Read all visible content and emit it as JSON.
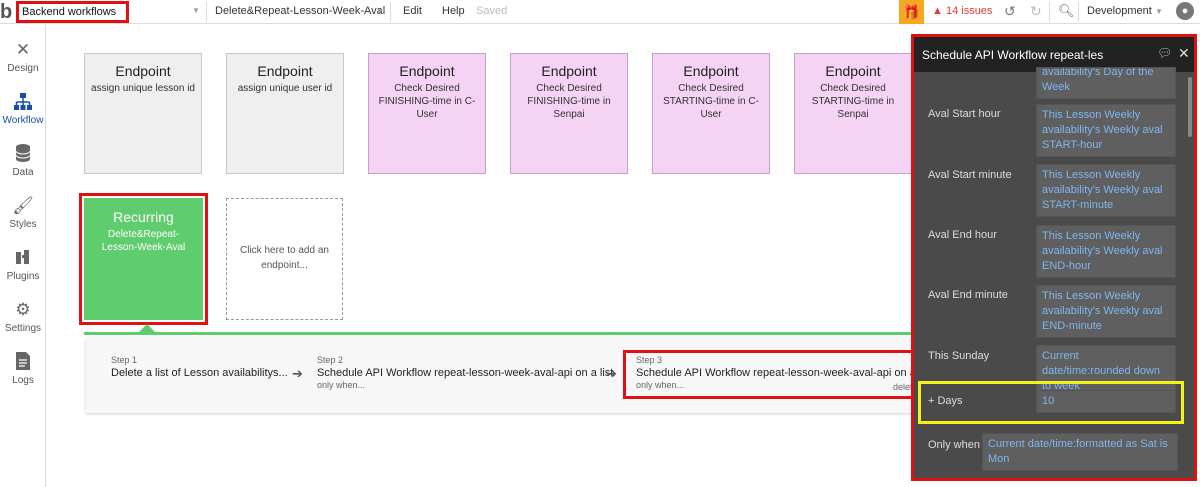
{
  "topbar": {
    "logo": "b",
    "page_selector": "Backend workflows",
    "workflow_selector": "Delete&Repeat-Lesson-Week-Aval",
    "menu_edit": "Edit",
    "menu_help": "Help",
    "saved_status": "Saved",
    "issues": "14 issues",
    "environment": "Development",
    "icons": {
      "gift": "gift-icon",
      "warning": "warning-icon",
      "undo": "undo-icon",
      "redo": "redo-icon",
      "search": "search-icon",
      "avatar": "avatar-icon"
    }
  },
  "sidebar": {
    "items": [
      {
        "label": "Design",
        "icon": "design-icon"
      },
      {
        "label": "Workflow",
        "icon": "workflow-icon"
      },
      {
        "label": "Data",
        "icon": "data-icon"
      },
      {
        "label": "Styles",
        "icon": "styles-icon"
      },
      {
        "label": "Plugins",
        "icon": "plugins-icon"
      },
      {
        "label": "Settings",
        "icon": "settings-icon"
      },
      {
        "label": "Logs",
        "icon": "logs-icon"
      }
    ],
    "active": "Workflow"
  },
  "endpoints": [
    {
      "title": "Endpoint",
      "subtitle": "assign unique lesson id",
      "color": "gray"
    },
    {
      "title": "Endpoint",
      "subtitle": "assign unique user id",
      "color": "gray"
    },
    {
      "title": "Endpoint",
      "subtitle": "Check Desired FINISHING-time in C-User",
      "color": "pink"
    },
    {
      "title": "Endpoint",
      "subtitle": "Check Desired FINISHING-time in Senpai",
      "color": "pink"
    },
    {
      "title": "Endpoint",
      "subtitle": "Check Desired STARTING-time in C-User",
      "color": "pink"
    },
    {
      "title": "Endpoint",
      "subtitle": "Check Desired STARTING-time in Senpai",
      "color": "pink"
    }
  ],
  "recurring": {
    "title": "Recurring",
    "subtitle": "Delete&Repeat-Lesson-Week-Aval"
  },
  "add_endpoint": "Click here to add an endpoint...",
  "steps": [
    {
      "number": "Step 1",
      "title": "Delete a list of Lesson availabilitys...",
      "condition": ""
    },
    {
      "number": "Step 2",
      "title": "Schedule API Workflow repeat-lesson-week-aval-api on a list",
      "condition": "only when..."
    },
    {
      "number": "Step 3",
      "title": "Schedule API Workflow repeat-lesson-week-aval-api on a list",
      "condition": "only when...",
      "delete": "delete"
    }
  ],
  "property_editor": {
    "title": "Schedule API Workflow repeat-les",
    "top_partial": "availability's Day of the Week",
    "fields": [
      {
        "label": "Aval Start hour",
        "value": "This Lesson Weekly availability's Weekly aval START-hour"
      },
      {
        "label": "Aval Start minute",
        "value": "This Lesson Weekly availability's Weekly aval START-minute"
      },
      {
        "label": "Aval End hour",
        "value": "This Lesson Weekly availability's Weekly aval END-hour"
      },
      {
        "label": "Aval End minute",
        "value": "This Lesson Weekly availability's Weekly aval END-minute"
      },
      {
        "label": "This Sunday",
        "value": "Current date/time:rounded down to week"
      }
    ],
    "days": {
      "label": "+ Days",
      "value": "10"
    },
    "only_when": {
      "label": "Only when",
      "value": "Current date/time:formatted as Sat is Mon"
    }
  },
  "colors": {
    "highlight_red": "#e01010",
    "highlight_yellow": "#f2f21a",
    "recurring_green": "#5fcc6e",
    "endpoint_pink": "#f4d3f4",
    "dynamic_blue": "#7fb6ef"
  }
}
